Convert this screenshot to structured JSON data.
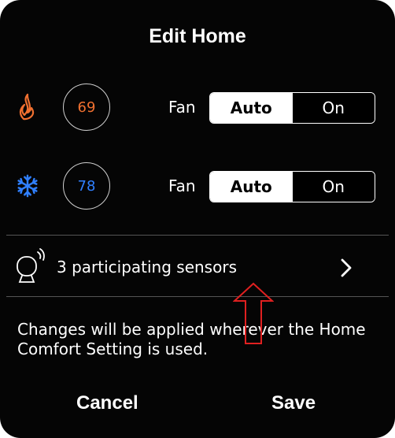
{
  "dialog": {
    "title": "Edit Home"
  },
  "heat": {
    "icon": "flame-icon",
    "setpoint": "69",
    "fan_label": "Fan",
    "options": [
      "Auto",
      "On"
    ],
    "selected": "Auto"
  },
  "cool": {
    "icon": "snowflake-icon",
    "setpoint": "78",
    "fan_label": "Fan",
    "options": [
      "Auto",
      "On"
    ],
    "selected": "Auto"
  },
  "sensors": {
    "icon": "sensor-icon",
    "label": "3 participating sensors",
    "chevron": "chevron-right-icon"
  },
  "note": "Changes will be applied wherever the Home Comfort Setting is used.",
  "actions": {
    "cancel": "Cancel",
    "save": "Save"
  },
  "annotation": {
    "icon": "red-up-arrow",
    "color": "#e02020"
  },
  "colors": {
    "heat": "#f07030",
    "cool": "#3080ff",
    "background": "#050505"
  }
}
